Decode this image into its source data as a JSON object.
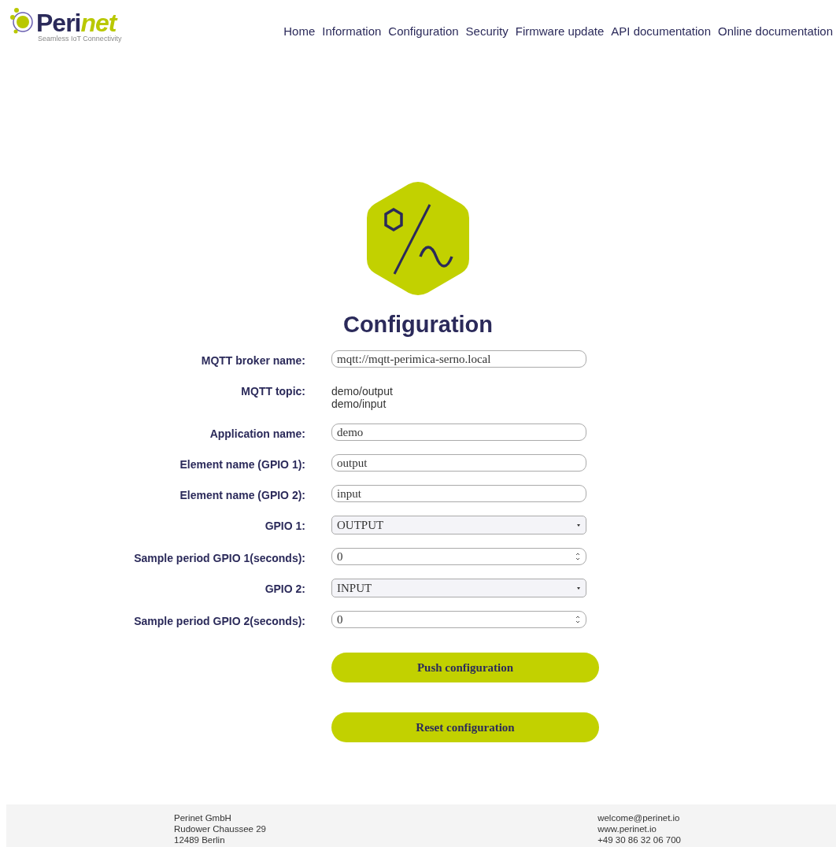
{
  "logo": {
    "name_dark": "Peri",
    "name_light": "net",
    "tagline": "Seamless IoT Connectivity"
  },
  "nav": [
    "Home",
    "Information",
    "Configuration",
    "Security",
    "Firmware update",
    "API documentation",
    "Online documentation"
  ],
  "title": "Configuration",
  "fields": [
    {
      "kind": "text",
      "label": "MQTT broker name:",
      "value": "mqtt://mqtt-perimica-serno.local"
    },
    {
      "kind": "lines",
      "label": "MQTT topic:",
      "lines": [
        "demo/output",
        "demo/input"
      ]
    },
    {
      "kind": "text",
      "label": "Application name:",
      "value": "demo"
    },
    {
      "kind": "text",
      "label": "Element name (GPIO 1):",
      "value": "output"
    },
    {
      "kind": "text",
      "label": "Element name (GPIO 2):",
      "value": "input"
    },
    {
      "kind": "select",
      "label": "GPIO 1:",
      "value": "OUTPUT"
    },
    {
      "kind": "number",
      "label": "Sample period GPIO 1(seconds):",
      "value": "0"
    },
    {
      "kind": "select",
      "label": "GPIO 2:",
      "value": "INPUT"
    },
    {
      "kind": "number",
      "label": "Sample period GPIO 2(seconds):",
      "value": "0"
    }
  ],
  "buttons": [
    "Push configuration",
    "Reset configuration"
  ],
  "footer": {
    "left": [
      "Perinet GmbH",
      "Rudower Chaussee 29",
      "12489 Berlin"
    ],
    "right": [
      "welcome@perinet.io",
      "www.perinet.io",
      "+49 30 86 32 06 700"
    ]
  }
}
